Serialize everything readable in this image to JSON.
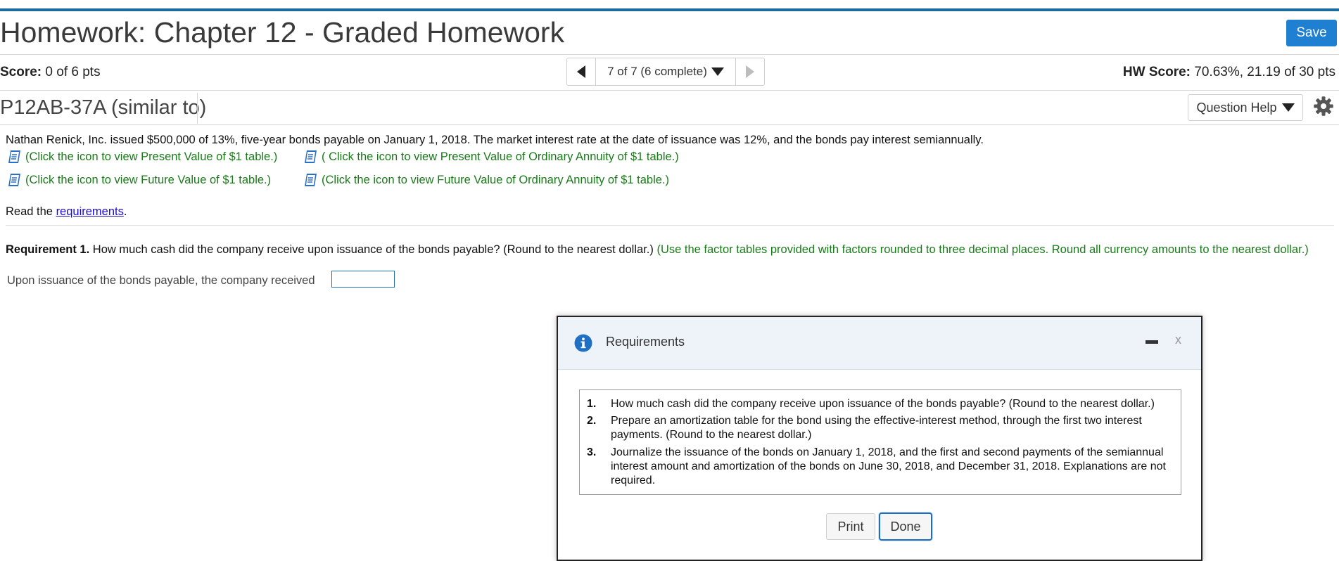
{
  "header": {
    "title": "Homework: Chapter 12 - Graded Homework",
    "save_label": "Save"
  },
  "score": {
    "label": "Score:",
    "value": "0 of 6 pts"
  },
  "nav": {
    "position": "7 of 7 (6 complete)"
  },
  "hw_score": {
    "label": "HW Score:",
    "value": "70.63%, 21.19 of 30 pts"
  },
  "question": {
    "id": "P12AB-37A (similar to)",
    "help_label": "Question Help"
  },
  "problem": {
    "text": "Nathan Renick, Inc. issued $500,000 of 13%, five-year bonds payable on January 1, 2018. The market interest rate at the date of issuance was 12%, and the bonds pay interest semiannually.",
    "links": [
      "(Click the icon to view Present Value of $1 table.)",
      "( Click the icon to view Present Value of Ordinary Annuity of $1 table.)",
      "(Click the icon to view Future Value of $1 table.)",
      "(Click the icon to view Future Value of Ordinary Annuity of $1 table.)"
    ],
    "read_prefix": "Read the ",
    "read_link": "requirements",
    "read_suffix": "."
  },
  "requirement1": {
    "label": "Requirement 1.",
    "question": " How much cash did the company receive upon issuance of the bonds payable? (Round to the nearest dollar.) ",
    "instruction": "(Use the factor tables provided with factors rounded to three decimal places. Round all currency amounts to the nearest dollar.)",
    "answer_label": "Upon issuance of the bonds payable, the company received",
    "answer_value": ""
  },
  "dialog": {
    "title": "Requirements",
    "close_label": "x",
    "items": [
      {
        "num": "1.",
        "text": "How much cash did the company receive upon issuance of the bonds payable? (Round to the nearest dollar.)"
      },
      {
        "num": "2.",
        "text": "Prepare an amortization table for the bond using the effective-interest method, through the first two interest payments. (Round to the nearest dollar.)"
      },
      {
        "num": "3.",
        "text": "Journalize the issuance of the bonds on January 1, 2018, and the first and second payments of the semiannual interest amount and amortization of the bonds on June 30, 2018, and December 31, 2018. Explanations are not required."
      }
    ],
    "print_label": "Print",
    "done_label": "Done"
  },
  "colors": {
    "accent": "#1f7fd1",
    "link_green": "#1a7a1a",
    "top_bar": "#1b6b9e"
  },
  "icons": [
    "book-icon",
    "info-icon",
    "gear-icon",
    "chevron-down-icon",
    "prev-arrow-icon",
    "next-arrow-icon",
    "minimize-icon",
    "close-icon"
  ]
}
